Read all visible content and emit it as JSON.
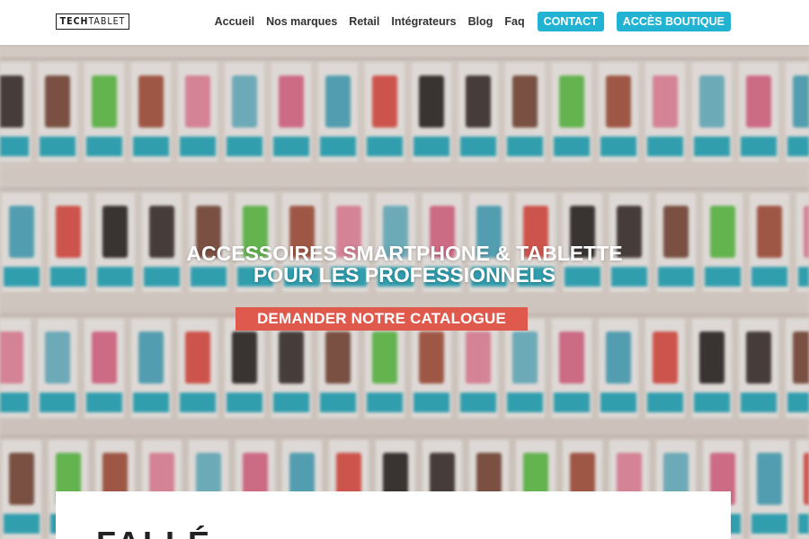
{
  "brand": {
    "logo_bold": "TECH",
    "logo_light": "TABLET"
  },
  "nav": {
    "items": [
      {
        "label": "Accueil"
      },
      {
        "label": "Nos marques"
      },
      {
        "label": "Retail"
      },
      {
        "label": "Intégrateurs"
      },
      {
        "label": "Blog"
      },
      {
        "label": "Faq"
      }
    ],
    "contact_label": "CONTACT",
    "shop_label": "ACCÈS BOUTIQUE"
  },
  "hero": {
    "title_line1": "ACCESSOIRES SMARTPHONE & TABLETTE",
    "title_line2": "POUR LES PROFESSIONNELS",
    "cta_label": "DEMANDER NOTRE CATALOGUE"
  },
  "panel": {
    "heading_partial": "FALLÉ"
  },
  "colors": {
    "accent_cyan": "#21b3d1",
    "cta_red": "#df5a4c",
    "header_bg": "#ffffff",
    "text_dark": "#333333"
  }
}
